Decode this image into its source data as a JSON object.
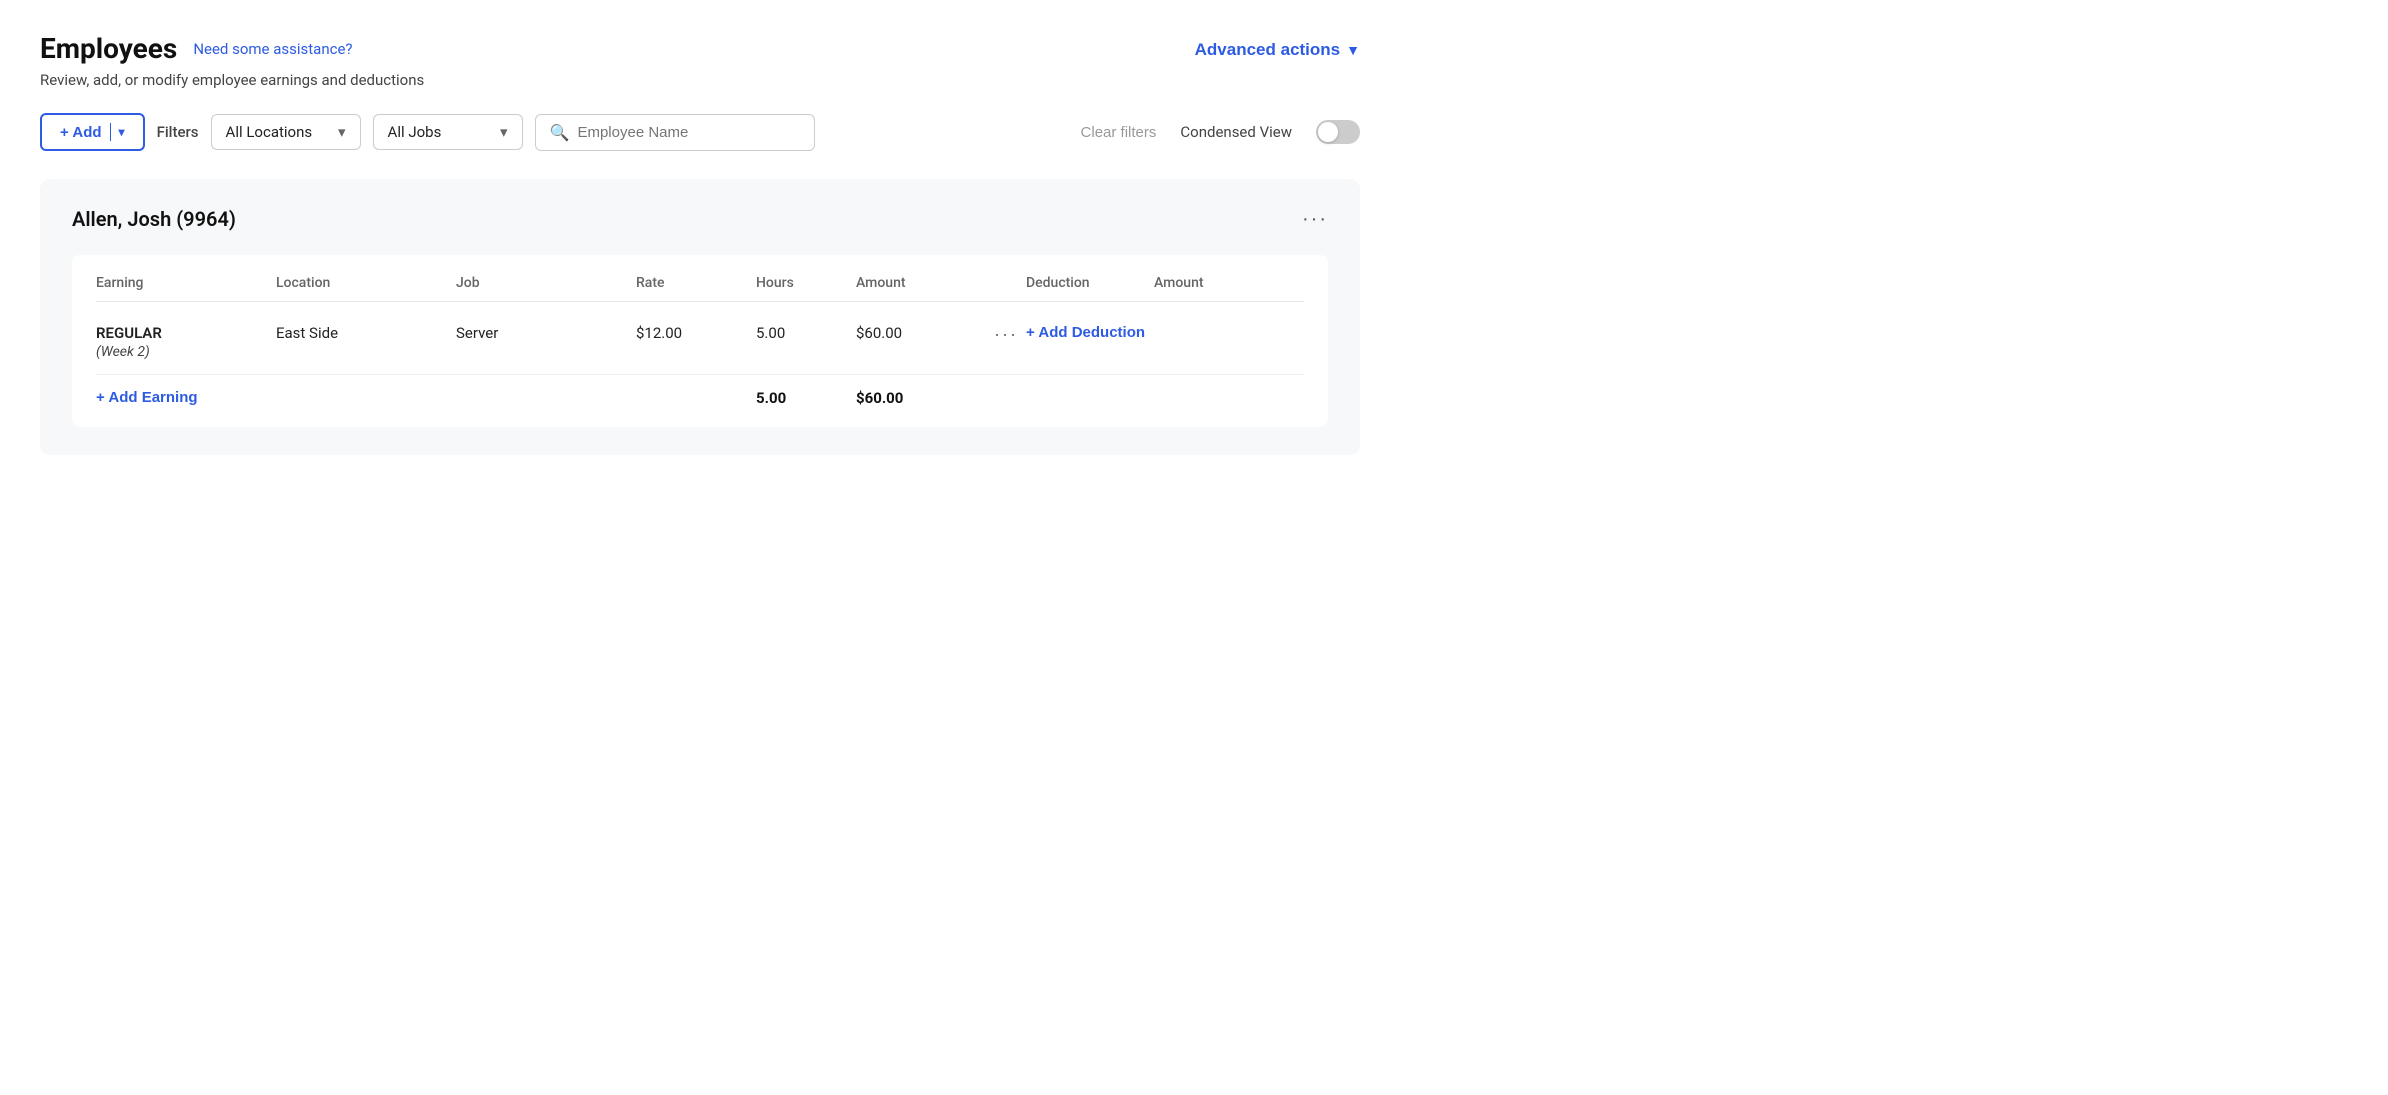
{
  "page": {
    "title": "Employees",
    "help_link": "Need some assistance?",
    "subtitle": "Review, add, or modify employee earnings and deductions"
  },
  "header": {
    "advanced_actions_label": "Advanced actions"
  },
  "toolbar": {
    "add_label": "+ Add",
    "filters_label": "Filters",
    "all_locations_label": "All Locations",
    "all_jobs_label": "All Jobs",
    "search_placeholder": "Employee Name",
    "clear_filters_label": "Clear filters",
    "condensed_view_label": "Condensed View"
  },
  "employee": {
    "name": "Allen, Josh (9964)"
  },
  "table": {
    "headers": {
      "earning": "Earning",
      "location": "Location",
      "job": "Job",
      "rate": "Rate",
      "hours": "Hours",
      "amount": "Amount",
      "deduction": "Deduction",
      "deduction_amount": "Amount"
    },
    "rows": [
      {
        "earning": "REGULAR",
        "earning_sub": "(Week 2)",
        "location": "East Side",
        "job": "Server",
        "rate": "$12.00",
        "hours": "5.00",
        "amount": "$60.00"
      }
    ],
    "totals": {
      "hours": "5.00",
      "amount": "$60.00"
    },
    "add_earning_label": "+ Add Earning",
    "add_deduction_label": "+ Add Deduction"
  }
}
